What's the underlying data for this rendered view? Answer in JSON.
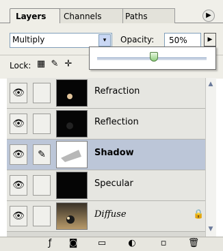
{
  "tabs": [
    {
      "label": "Layers",
      "active": true
    },
    {
      "label": "Channels",
      "active": false
    },
    {
      "label": "Paths",
      "active": false
    }
  ],
  "panel_menu_icon": "triangle-right",
  "blend": {
    "value": "Multiply",
    "arrow": "▾"
  },
  "opacity": {
    "label": "Opacity:",
    "value": "50%",
    "slider_value_percent": 50
  },
  "lock": {
    "label": "Lock:",
    "icons": [
      "transparency-lock-icon",
      "brush-lock-icon",
      "move-lock-icon"
    ]
  },
  "layers": [
    {
      "name": "Refraction",
      "selected": false,
      "style": "normal",
      "locked": false
    },
    {
      "name": "Reflection",
      "selected": false,
      "style": "normal",
      "locked": false
    },
    {
      "name": "Shadow",
      "selected": true,
      "style": "bold",
      "locked": false
    },
    {
      "name": "Specular",
      "selected": false,
      "style": "normal",
      "locked": false
    },
    {
      "name": "Diffuse",
      "selected": false,
      "style": "italic",
      "locked": true
    }
  ],
  "bottom_icons": [
    "link-icon",
    "layer-style-icon",
    "mask-icon",
    "folder-icon",
    "adjustment-icon",
    "new-layer-icon",
    "trash-icon"
  ],
  "colors": {
    "selected_row": "#bcc6d8",
    "row": "#e6e6e1",
    "panel": "#efeee7"
  }
}
